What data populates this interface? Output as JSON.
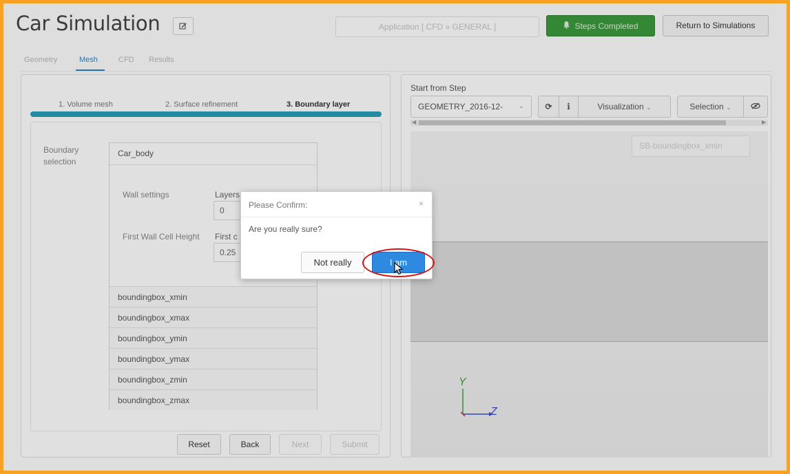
{
  "header": {
    "title": "Car Simulation",
    "edit_icon": "pencil-icon",
    "application_label": "Application [ CFD » GENERAL ]",
    "steps_completed_label": "Steps Completed",
    "bell_icon": "bell-icon",
    "return_label": "Return to Simulations",
    "colors": {
      "success": "#3c9a3c",
      "frame": "#f7a325"
    }
  },
  "tabs": [
    {
      "label": "Geometry"
    },
    {
      "label": "Mesh",
      "active": true
    },
    {
      "label": "CFD"
    },
    {
      "label": "Results"
    }
  ],
  "wizard": {
    "steps": [
      "1. Volume mesh",
      "2. Surface refinement",
      "3. Boundary layer"
    ],
    "current_step": 3,
    "progress_color": "#2aa0b8"
  },
  "boundary": {
    "section_label": "Boundary selection",
    "selected": "Car_body",
    "items": [
      "boundingbox_xmin",
      "boundingbox_xmax",
      "boundingbox_ymin",
      "boundingbox_ymax",
      "boundingbox_zmin",
      "boundingbox_zmax"
    ],
    "wall_settings_label": "Wall settings",
    "layers_number_label": "Layers Number",
    "layers_number_value": "0",
    "first_wall_label": "First Wall Cell Height",
    "first_cell_label": "First c",
    "first_cell_value": "0.25"
  },
  "buttons": {
    "reset": "Reset",
    "back": "Back",
    "next": "Next",
    "submit": "Submit"
  },
  "viewer": {
    "start_from_step_label": "Start from Step",
    "step_value": "GEOMETRY_2016-12-",
    "refresh_icon": "refresh-icon",
    "info_icon": "info-icon",
    "visualization_label": "Visualization",
    "selection_label": "Selection",
    "eye_icon": "eye-slash-icon",
    "sb_placeholder": "SB-boundingbox_xmin",
    "axis_y": "Y",
    "axis_z": "Z"
  },
  "dialog": {
    "title": "Please Confirm:",
    "close_icon": "close-icon",
    "message": "Are you really sure?",
    "cancel_label": "Not really",
    "confirm_label": "I am",
    "confirm_color": "#2d8ae0"
  }
}
